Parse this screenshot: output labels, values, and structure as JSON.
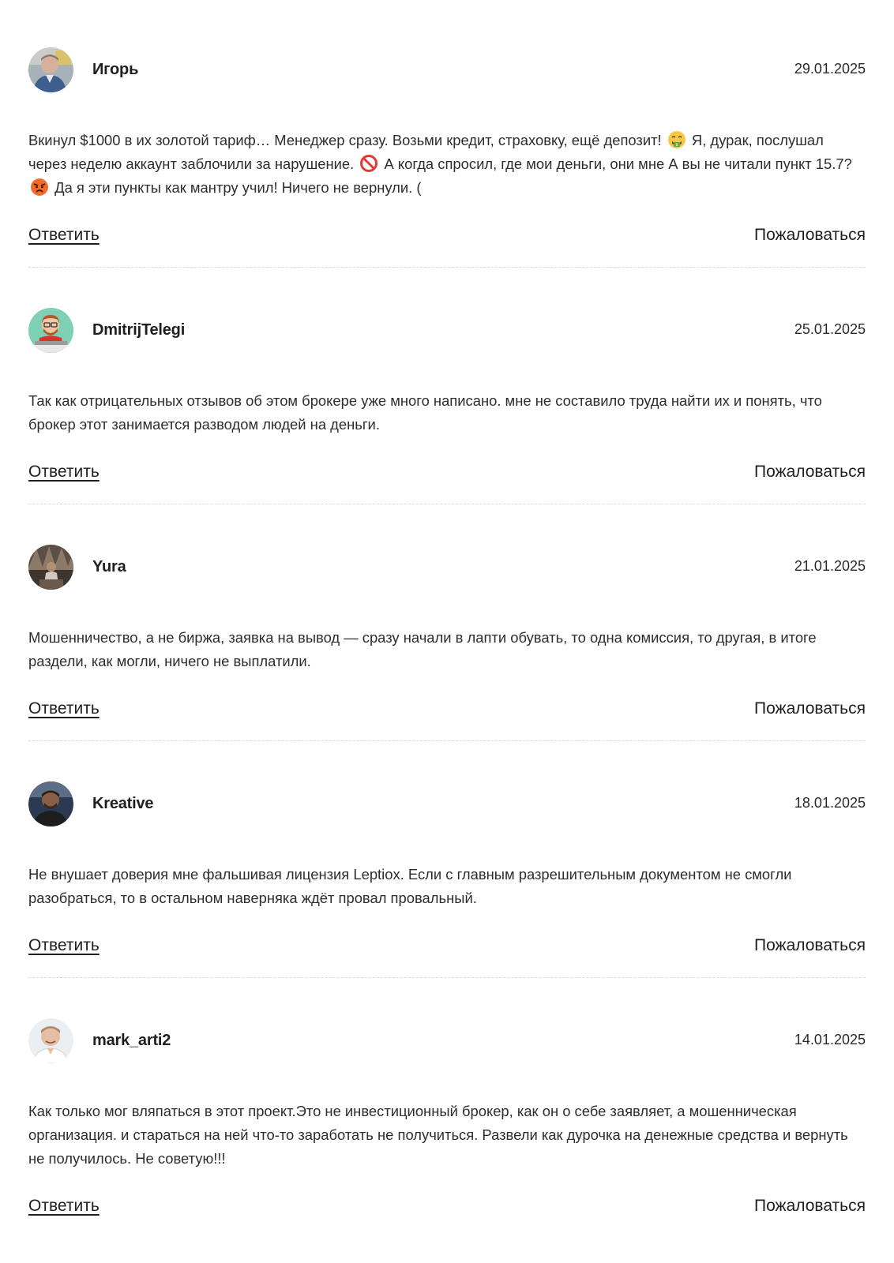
{
  "comments": [
    {
      "author": "Игорь",
      "date": "29.01.2025",
      "text_parts": [
        "Вкинул $1000 в их золотой тариф… Менеджер сразу. Возьми кредит, страховку, ещё депозит!",
        "Я, дурак, послушал через неделю аккаунт заблочили за нарушение.",
        "А когда спросил, где мои деньги, они мне А вы не читали пункт 15.7?",
        "Да я эти пункты как мантру учил! Ничего не вернули. ("
      ],
      "emojis": [
        "money-mouth-face-icon",
        "prohibited-icon",
        "angry-face-icon"
      ],
      "reply_label": "Ответить",
      "report_label": "Пожаловаться"
    },
    {
      "author": "DmitrijTelegi",
      "date": "25.01.2025",
      "text": "Так как отрицательных отзывов об этом брокере уже много написано. мне не составило труда найти их и понять, что брокер этот занимается разводом людей на деньги.",
      "reply_label": "Ответить",
      "report_label": "Пожаловаться"
    },
    {
      "author": "Yura",
      "date": "21.01.2025",
      "text": "Мошенничество, а не биржа, заявка на вывод — сразу начали в лапти обувать, то одна комиссия, то другая, в итоге раздели, как могли, ничего не выплатили.",
      "reply_label": "Ответить",
      "report_label": "Пожаловаться"
    },
    {
      "author": "Kreative",
      "date": "18.01.2025",
      "text": "Не внушает доверия мне фальшивая лицензия Leptiox. Если с главным разрешительным документом не смогли разобраться, то в остальном наверняка ждёт провал провальный.",
      "reply_label": "Ответить",
      "report_label": "Пожаловаться"
    },
    {
      "author": "mark_arti2",
      "date": "14.01.2025",
      "text": "Как только мог вляпаться в этот проект.Это не инвестиционный брокер, как он о себе заявляет, а мошенническая организация. и стараться на ней что-то заработать не получиться. Развели как дурочка на денежные средства и вернуть не получилось. Не советую!!!",
      "reply_label": "Ответить",
      "report_label": "Пожаловаться"
    }
  ]
}
